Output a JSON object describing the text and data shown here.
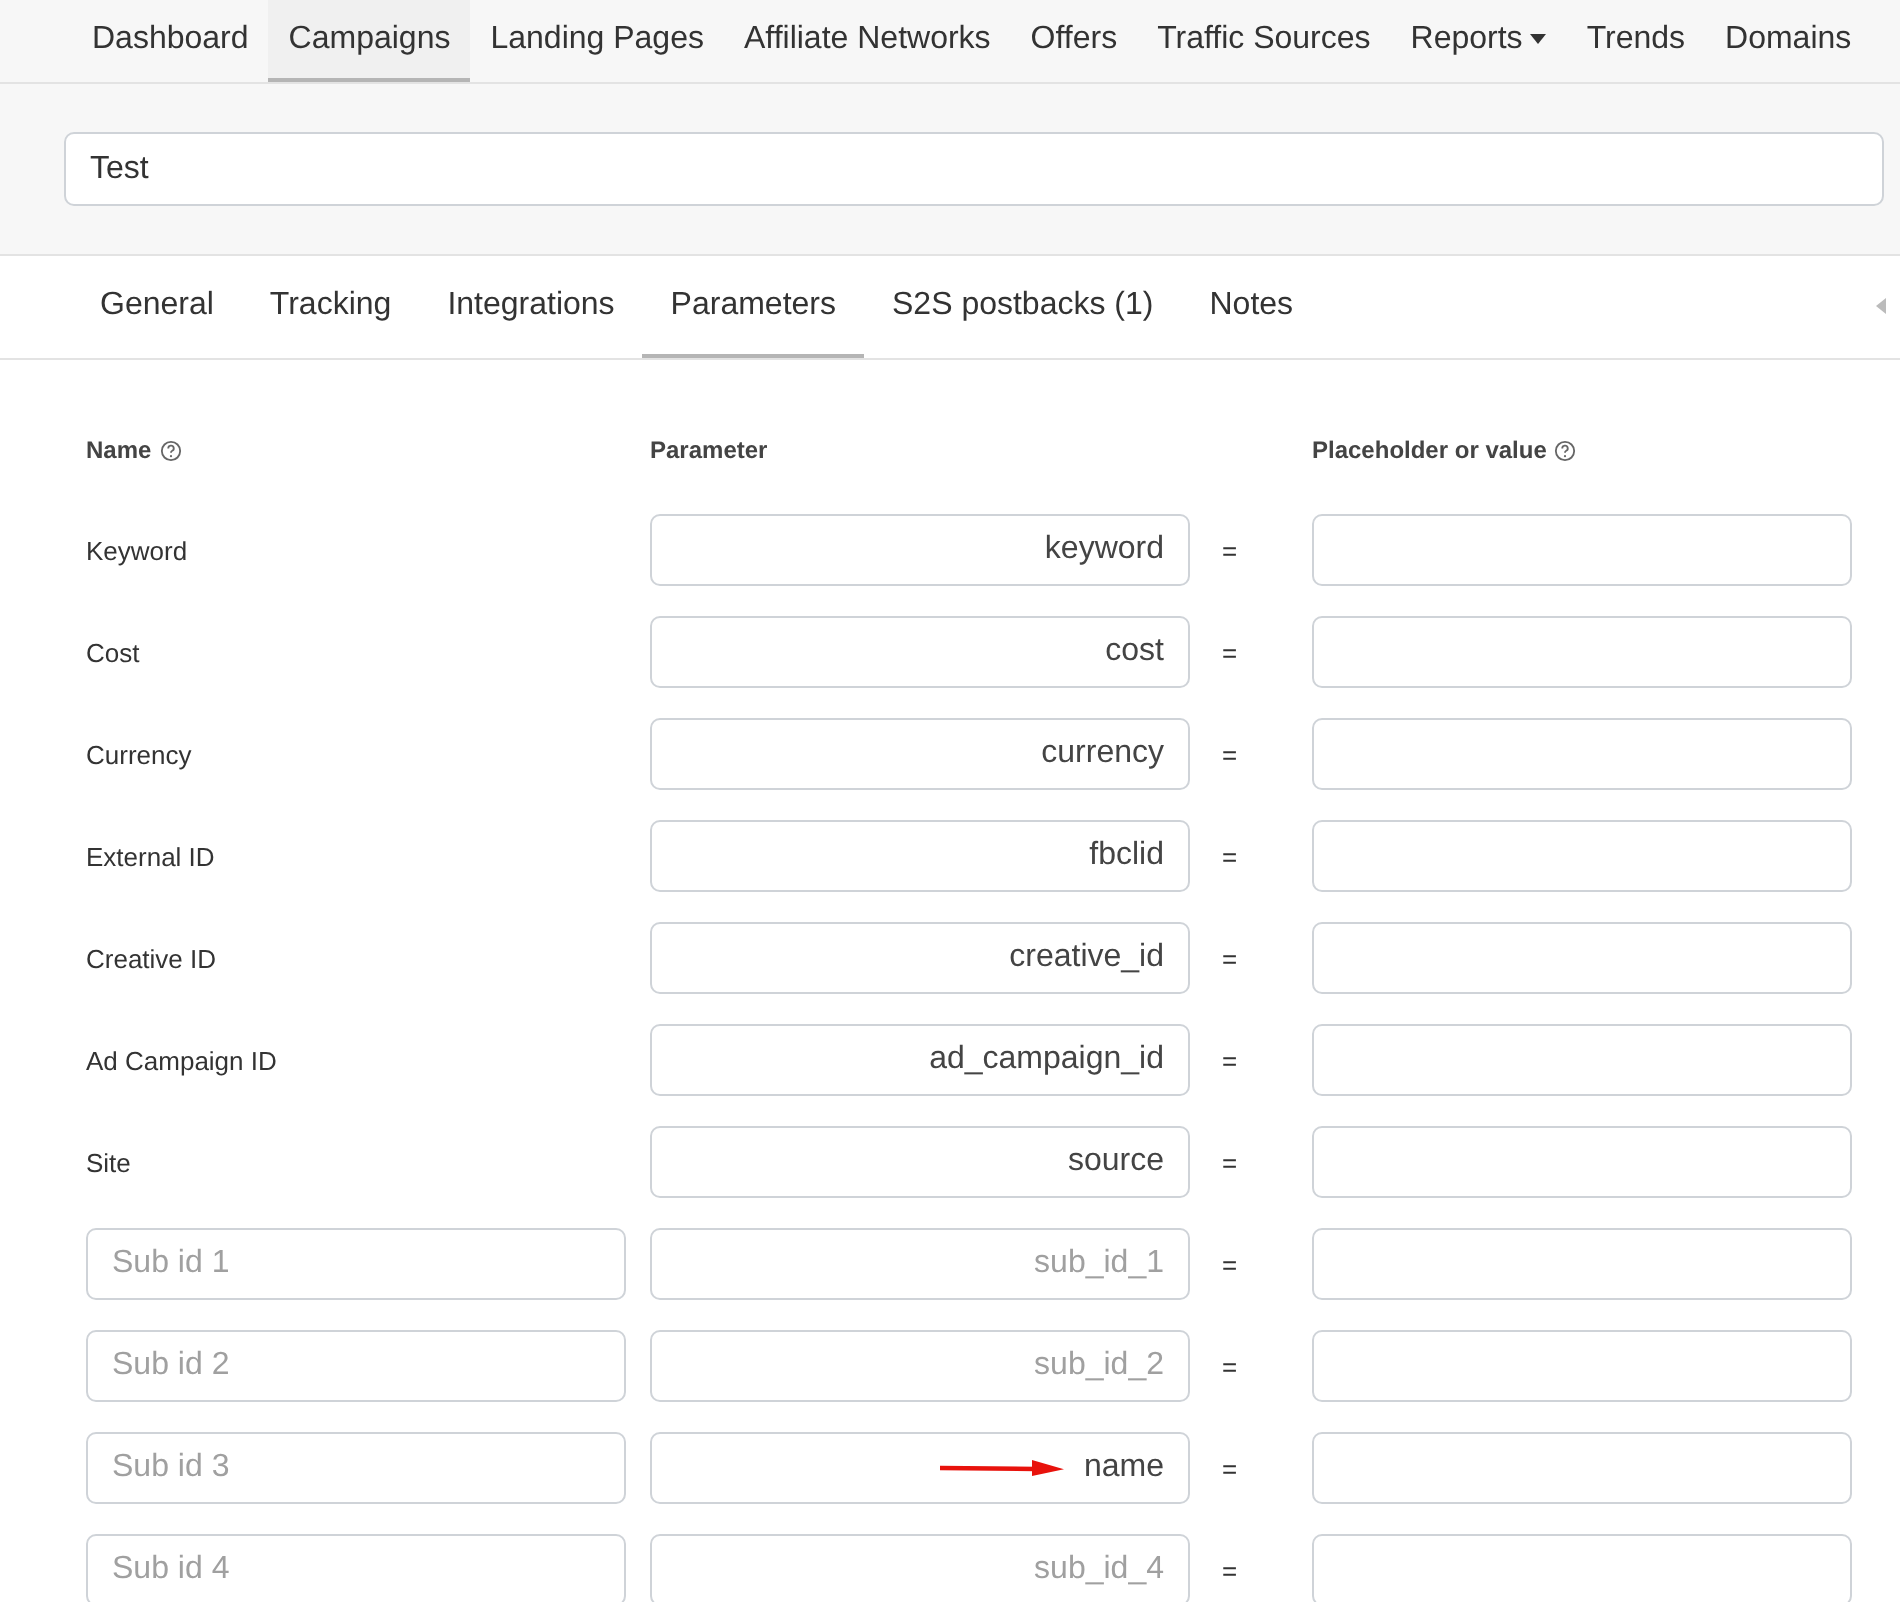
{
  "nav": [
    {
      "label": "Dashboard",
      "selected": false,
      "dropdown": false
    },
    {
      "label": "Campaigns",
      "selected": true,
      "dropdown": false
    },
    {
      "label": "Landing Pages",
      "selected": false,
      "dropdown": false
    },
    {
      "label": "Affiliate Networks",
      "selected": false,
      "dropdown": false
    },
    {
      "label": "Offers",
      "selected": false,
      "dropdown": false
    },
    {
      "label": "Traffic Sources",
      "selected": false,
      "dropdown": false
    },
    {
      "label": "Reports",
      "selected": false,
      "dropdown": true
    },
    {
      "label": "Trends",
      "selected": false,
      "dropdown": false
    },
    {
      "label": "Domains",
      "selected": false,
      "dropdown": false
    }
  ],
  "campaign_name": {
    "value": "Test"
  },
  "tabs": [
    {
      "label": "General",
      "selected": false
    },
    {
      "label": "Tracking",
      "selected": false
    },
    {
      "label": "Integrations",
      "selected": false
    },
    {
      "label": "Parameters",
      "selected": true
    },
    {
      "label": "S2S postbacks (1)",
      "selected": false
    },
    {
      "label": "Notes",
      "selected": false
    }
  ],
  "columns": [
    {
      "label": "Name",
      "help": true
    },
    {
      "label": "Parameter",
      "help": false
    },
    {
      "label": "Placeholder or value",
      "help": true
    }
  ],
  "equals": "=",
  "rows": [
    {
      "kind": "fixed",
      "name": "Keyword",
      "parameter": {
        "value": "keyword"
      },
      "arrow": false
    },
    {
      "kind": "fixed",
      "name": "Cost",
      "parameter": {
        "value": "cost"
      },
      "arrow": false
    },
    {
      "kind": "fixed",
      "name": "Currency",
      "parameter": {
        "value": "currency"
      },
      "arrow": false
    },
    {
      "kind": "fixed",
      "name": "External ID",
      "parameter": {
        "value": "fbclid"
      },
      "arrow": false
    },
    {
      "kind": "fixed",
      "name": "Creative ID",
      "parameter": {
        "value": "creative_id"
      },
      "arrow": false
    },
    {
      "kind": "fixed",
      "name": "Ad Campaign ID",
      "parameter": {
        "value": "ad_campaign_id"
      },
      "arrow": false
    },
    {
      "kind": "fixed",
      "name": "Site",
      "parameter": {
        "value": "source"
      },
      "arrow": false
    },
    {
      "kind": "custom",
      "name_placeholder": "Sub id 1",
      "parameter": {
        "placeholder": "sub_id_1"
      },
      "arrow": false
    },
    {
      "kind": "custom",
      "name_placeholder": "Sub id 2",
      "parameter": {
        "placeholder": "sub_id_2"
      },
      "arrow": false
    },
    {
      "kind": "custom",
      "name_placeholder": "Sub id 3",
      "parameter": {
        "value": "name"
      },
      "arrow": true
    },
    {
      "kind": "custom",
      "name_placeholder": "Sub id 4",
      "parameter": {
        "placeholder": "sub_id_4"
      },
      "arrow": false
    }
  ]
}
